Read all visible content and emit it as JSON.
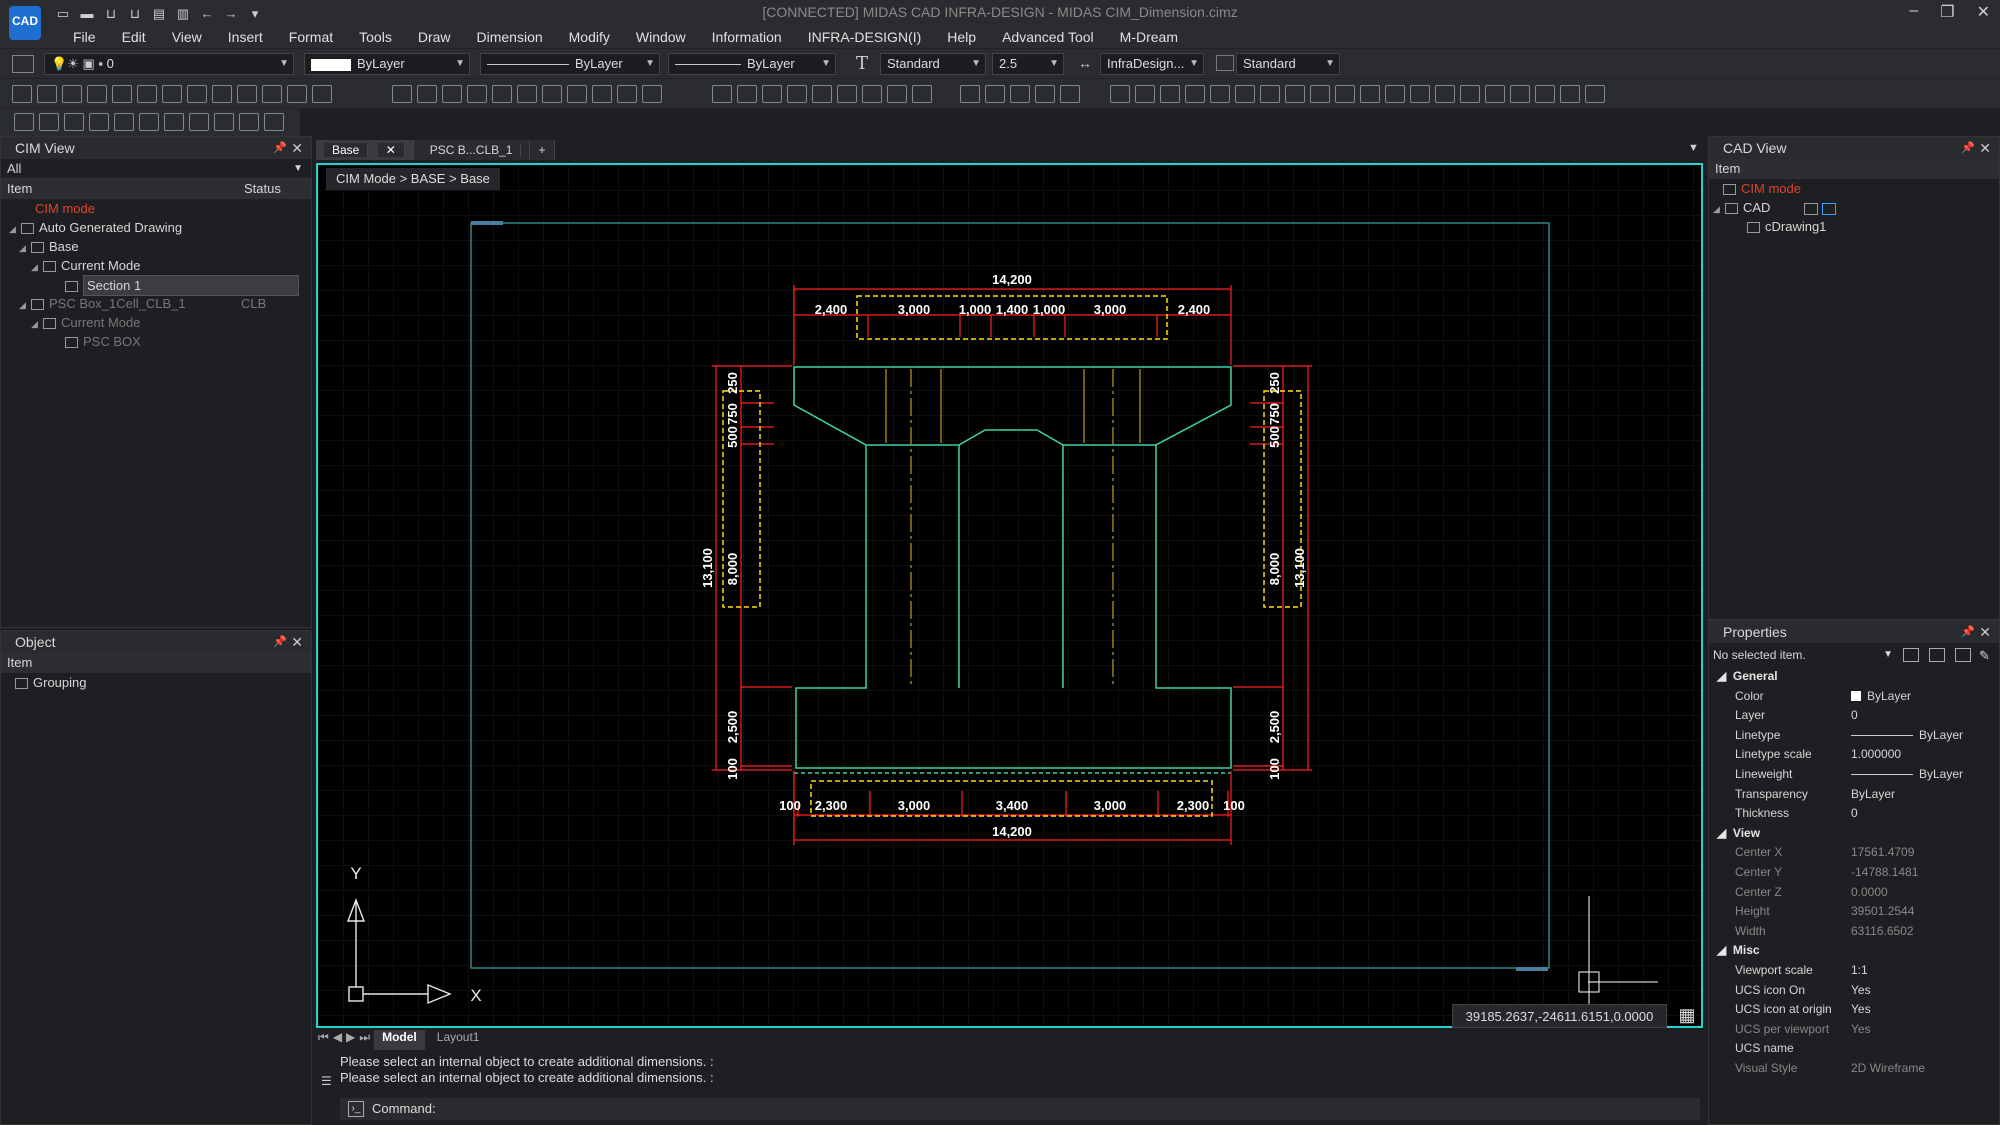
{
  "app": {
    "logo_text": "CAD",
    "title": "[CONNECTED] MIDAS CAD INFRA-DESIGN - MIDAS CIM_Dimension.cimz"
  },
  "menu": [
    "File",
    "Edit",
    "View",
    "Insert",
    "Format",
    "Tools",
    "Draw",
    "Dimension",
    "Modify",
    "Window",
    "Information",
    "INFRA-DESIGN(I)",
    "Help",
    "Advanced Tool",
    "M-Dream"
  ],
  "toolbar": {
    "layer_value": "0",
    "color_value": "ByLayer",
    "linetype_value": "ByLayer",
    "lineweight_value": "ByLayer",
    "text_style": "Standard",
    "text_height": "2.5",
    "dim_style": "InfraDesign...",
    "table_style": "Standard"
  },
  "cim_view": {
    "title": "CIM View",
    "filter": "All",
    "col_item": "Item",
    "col_status": "Status",
    "items": [
      {
        "label": "CIM mode",
        "status": ""
      },
      {
        "label": "Auto Generated Drawing",
        "status": ""
      },
      {
        "label": "Base",
        "status": ""
      },
      {
        "label": "Current Mode",
        "status": ""
      },
      {
        "label": "Section 1",
        "status": ""
      },
      {
        "label": "PSC Box_1Cell_CLB_1",
        "status": "CLB"
      },
      {
        "label": "Current Mode",
        "status": ""
      },
      {
        "label": "PSC BOX",
        "status": ""
      }
    ]
  },
  "object_panel": {
    "title": "Object",
    "col_item": "Item",
    "items": [
      "Grouping"
    ]
  },
  "tabs": [
    "Base",
    "PSC B...CLB_1",
    "+"
  ],
  "breadcrumb": "CIM Mode > BASE > Base",
  "drawing": {
    "top_total": "14,200",
    "top_segs": [
      "2,400",
      "3,000",
      "1,000",
      "1,400",
      "1,000",
      "3,000",
      "2,400"
    ],
    "bottom_total": "14,200",
    "bottom_segs": [
      "100",
      "2,300",
      "3,000",
      "3,400",
      "3,000",
      "2,300",
      "100"
    ],
    "left_total": "13,100",
    "left_segs": [
      "250",
      "750",
      "500",
      "8,000",
      "2,500",
      "100"
    ],
    "right_total": "13,100",
    "right_segs": [
      "250",
      "750",
      "500",
      "8,000",
      "2,500",
      "100"
    ],
    "ucs_x": "X",
    "ucs_y": "Y"
  },
  "coord_readout": "39185.2637,-24611.6151,0.0000",
  "layout_tabs": {
    "model": "Model",
    "layout": "Layout1"
  },
  "command": {
    "history": [
      "Please select an internal object to create additional dimensions. :",
      "Please select an internal object to create additional dimensions. :"
    ],
    "prompt": "Command:"
  },
  "cad_view": {
    "title": "CAD View",
    "col_item": "Item",
    "items": [
      "CIM mode",
      "CAD",
      "cDrawing1"
    ]
  },
  "properties": {
    "title": "Properties",
    "selection": "No selected item.",
    "groups": [
      {
        "name": "General",
        "rows": [
          [
            "Color",
            "ByLayer"
          ],
          [
            "Layer",
            "0"
          ],
          [
            "Linetype",
            "ByLayer"
          ],
          [
            "Linetype scale",
            "1.000000"
          ],
          [
            "Lineweight",
            "ByLayer"
          ],
          [
            "Transparency",
            "ByLayer"
          ],
          [
            "Thickness",
            "0"
          ]
        ]
      },
      {
        "name": "View",
        "rows": [
          [
            "Center X",
            "17561.4709"
          ],
          [
            "Center Y",
            "-14788.1481"
          ],
          [
            "Center Z",
            "0.0000"
          ],
          [
            "Height",
            "39501.2544"
          ],
          [
            "Width",
            "63116.6502"
          ]
        ]
      },
      {
        "name": "Misc",
        "rows": [
          [
            "Viewport scale",
            "1:1"
          ],
          [
            "UCS icon On",
            "Yes"
          ],
          [
            "UCS icon at origin",
            "Yes"
          ],
          [
            "UCS per viewport",
            "Yes"
          ],
          [
            "UCS name",
            ""
          ],
          [
            "Visual Style",
            "2D Wireframe"
          ]
        ]
      }
    ]
  },
  "colors": {
    "viewport_border": "#2ad1d1",
    "section_line": "#3fd3a8",
    "dim_red": "#ff2020",
    "dim_text": "#ffffff",
    "highlight_yellow": "#ffe000",
    "accent_red": "#e0432b"
  }
}
